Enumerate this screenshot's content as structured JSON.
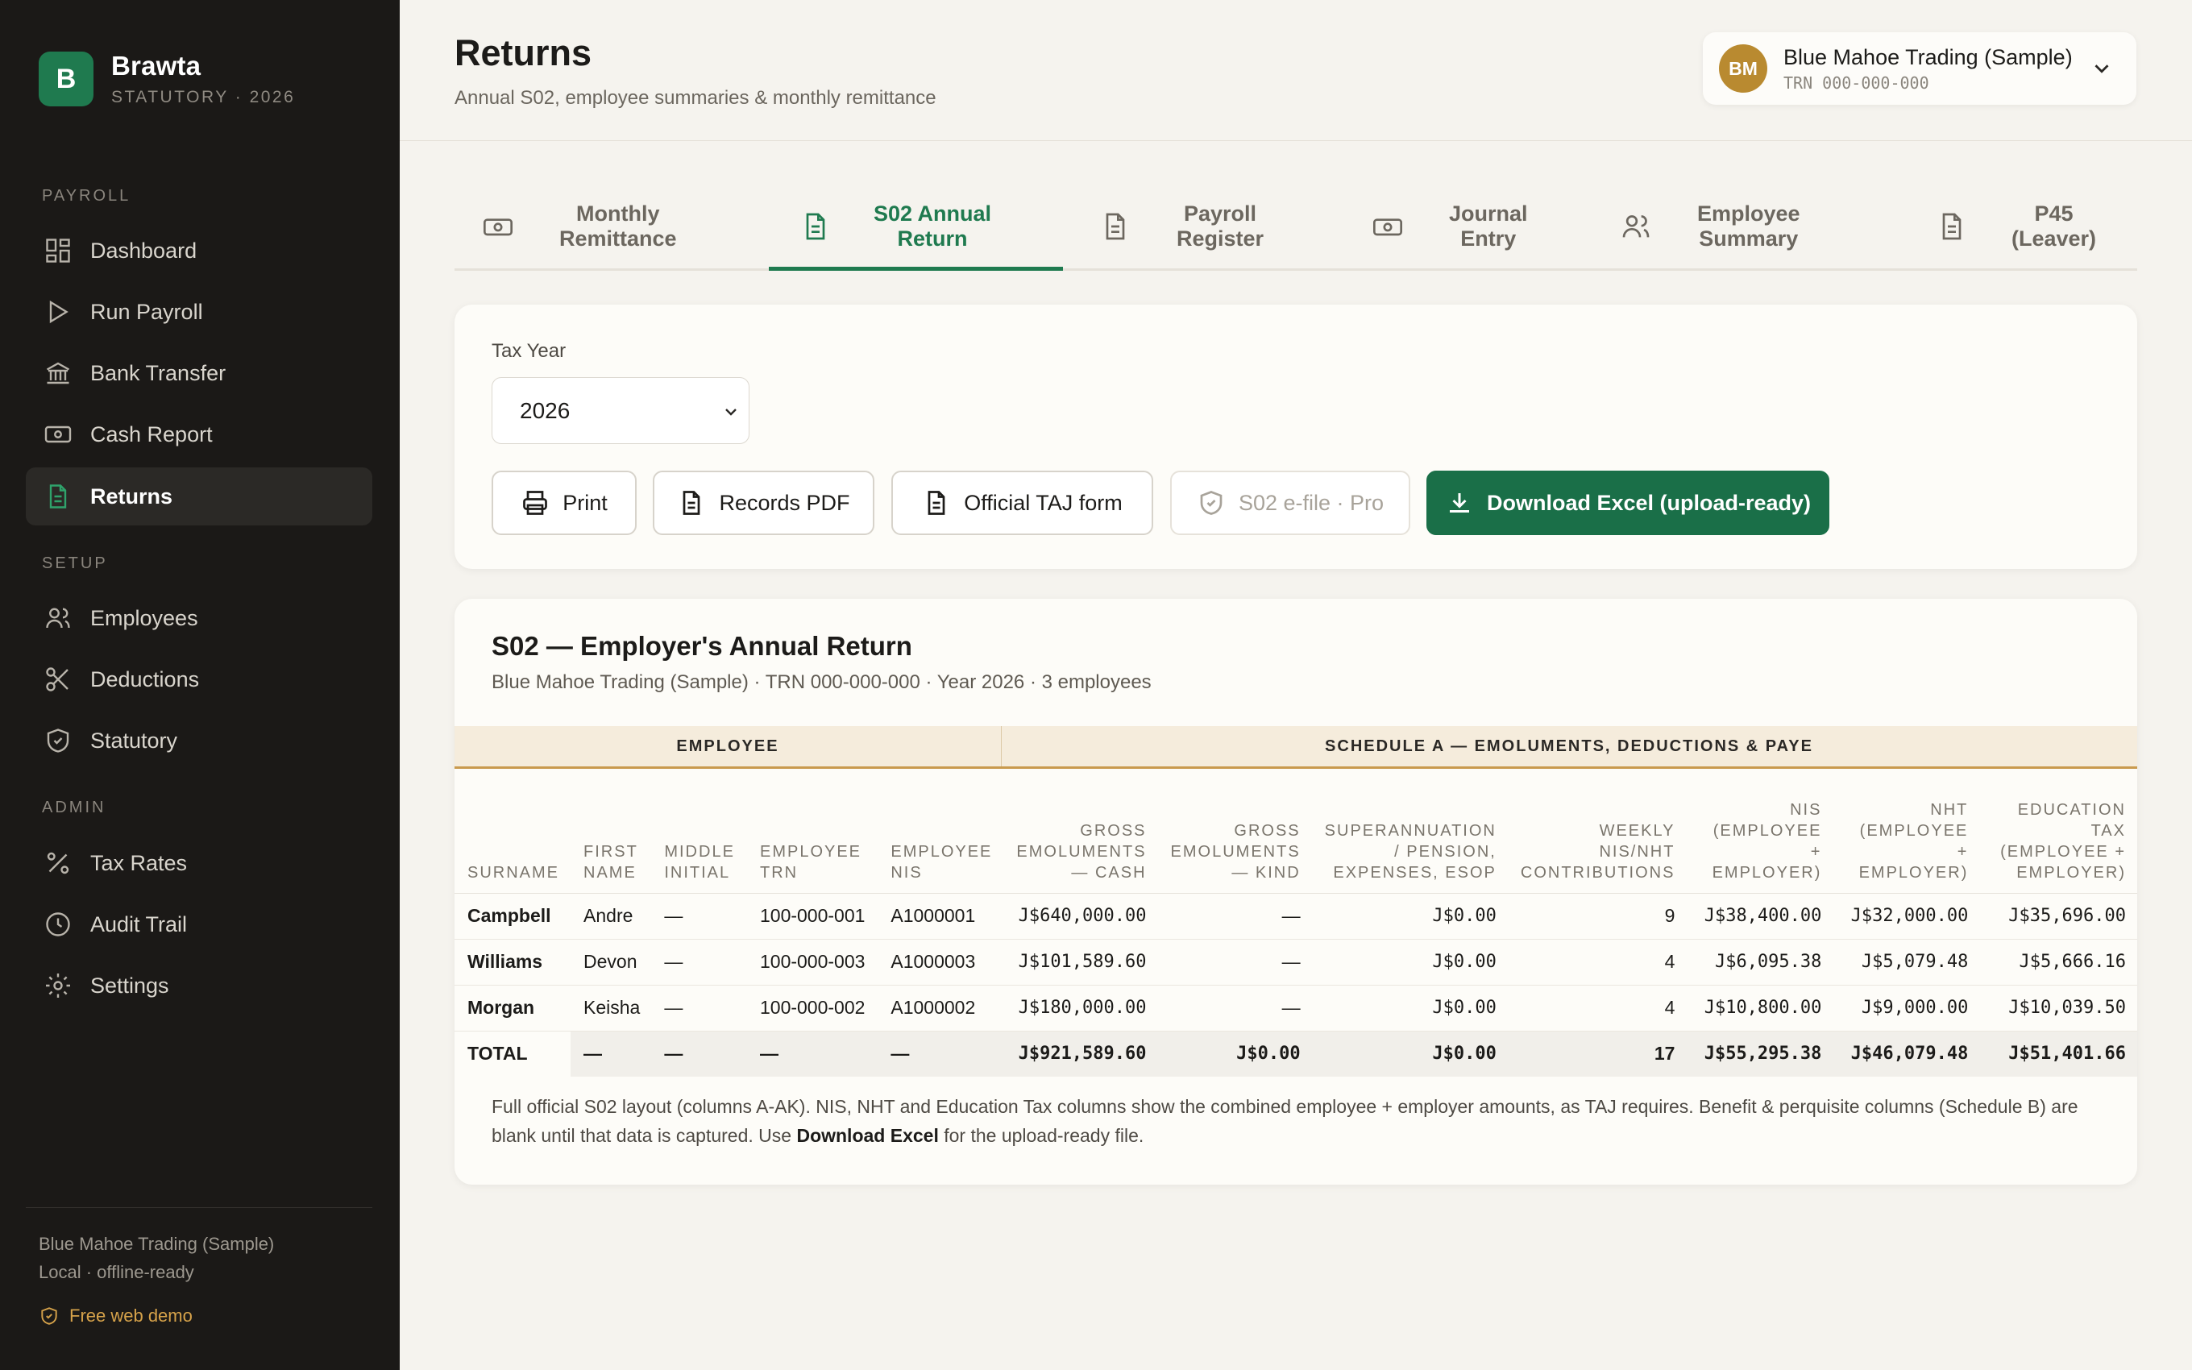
{
  "brand": {
    "logo_letter": "B",
    "name": "Brawta",
    "subtitle": "STATUTORY · 2026",
    "accent": "#1f7a4f"
  },
  "sidebar": {
    "sections": {
      "payroll": "PAYROLL",
      "setup": "SETUP",
      "admin": "ADMIN"
    },
    "items": [
      {
        "label": "Dashboard",
        "icon": "dashboard-icon"
      },
      {
        "label": "Run Payroll",
        "icon": "play-icon"
      },
      {
        "label": "Bank Transfer",
        "icon": "bank-icon"
      },
      {
        "label": "Cash Report",
        "icon": "cash-icon"
      },
      {
        "label": "Returns",
        "icon": "document-icon",
        "active": true
      },
      {
        "label": "Employees",
        "icon": "users-icon"
      },
      {
        "label": "Deductions",
        "icon": "scissors-icon"
      },
      {
        "label": "Statutory",
        "icon": "shield-icon"
      },
      {
        "label": "Tax Rates",
        "icon": "percent-icon"
      },
      {
        "label": "Audit Trail",
        "icon": "clock-icon"
      },
      {
        "label": "Settings",
        "icon": "gear-icon"
      }
    ],
    "footer_company": "Blue Mahoe Trading (Sample)",
    "footer_status": "Local · offline-ready",
    "demo_link": "Free web demo"
  },
  "header": {
    "title": "Returns",
    "subtitle": "Annual S02, employee summaries & monthly remittance",
    "company": {
      "initials": "BM",
      "name": "Blue Mahoe Trading (Sample)",
      "trn": "TRN 000-000-000"
    }
  },
  "tabs": [
    {
      "line1": "Monthly",
      "line2": "Remittance",
      "icon": "cash-icon"
    },
    {
      "line1": "S02 Annual",
      "line2": "Return",
      "icon": "document-icon",
      "active": true
    },
    {
      "line1": "Payroll",
      "line2": "Register",
      "icon": "document-icon"
    },
    {
      "line1": "Journal",
      "line2": "Entry",
      "icon": "cash-icon"
    },
    {
      "line1": "Employee",
      "line2": "Summary",
      "icon": "users-icon"
    },
    {
      "line1": "P45",
      "line2": "(Leaver)",
      "icon": "document-icon"
    }
  ],
  "controls": {
    "tax_year_label": "Tax Year",
    "tax_year_value": "2026",
    "buttons": {
      "print": "Print",
      "records_pdf": "Records PDF",
      "official_taj": "Official TAJ form",
      "efile": "S02 e-file · Pro",
      "download_excel": "Download Excel (upload-ready)"
    }
  },
  "s02": {
    "title": "S02 — Employer's Annual Return",
    "subtitle": "Blue Mahoe Trading (Sample) · TRN 000-000-000 · Year 2026 · 3 employees",
    "band_employee": "EMPLOYEE",
    "band_schedule": "SCHEDULE A — EMOLUMENTS, DEDUCTIONS & PAYE",
    "columns": [
      "SURNAME",
      "FIRST NAME",
      "MIDDLE INITIAL",
      "EMPLOYEE TRN",
      "EMPLOYEE NIS",
      "GROSS EMOLUMENTS — CASH",
      "GROSS EMOLUMENTS — KIND",
      "SUPERANNUATION / PENSION, EXPENSES, ESOP",
      "WEEKLY NIS/NHT CONTRIBUTIONS",
      "NIS (EMPLOYEE + EMPLOYER)",
      "NHT (EMPLOYEE + EMPLOYER)",
      "EDUCATION TAX (EMPLOYEE + EMPLOYER)"
    ],
    "rows": [
      [
        "Campbell",
        "Andre",
        "—",
        "100-000-001",
        "A1000001",
        "J$640,000.00",
        "—",
        "J$0.00",
        "9",
        "J$38,400.00",
        "J$32,000.00",
        "J$35,696.00"
      ],
      [
        "Williams",
        "Devon",
        "—",
        "100-000-003",
        "A1000003",
        "J$101,589.60",
        "—",
        "J$0.00",
        "4",
        "J$6,095.38",
        "J$5,079.48",
        "J$5,666.16"
      ],
      [
        "Morgan",
        "Keisha",
        "—",
        "100-000-002",
        "A1000002",
        "J$180,000.00",
        "—",
        "J$0.00",
        "4",
        "J$10,800.00",
        "J$9,000.00",
        "J$10,039.50"
      ]
    ],
    "total": [
      "TOTAL",
      "—",
      "—",
      "—",
      "—",
      "J$921,589.60",
      "J$0.00",
      "J$0.00",
      "17",
      "J$55,295.38",
      "J$46,079.48",
      "J$51,401.66"
    ],
    "footnote_pre": "Full official S02 layout (columns A-AK). NIS, NHT and Education Tax columns show the combined employee + employer amounts, as TAJ requires. Benefit & perquisite columns (Schedule B) are blank until that data is captured. Use ",
    "footnote_bold": "Download Excel",
    "footnote_post": " for the upload-ready file."
  }
}
